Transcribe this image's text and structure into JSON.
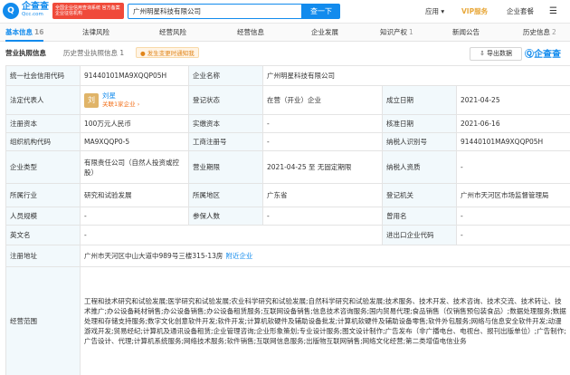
{
  "header": {
    "logo_mark": "Q",
    "logo_name": "企查查",
    "logo_domain": "Qcc.com",
    "slogan": "全国企业信用查询系统 官方备案企业征信机构",
    "search_value": "广州明星科技有限公司",
    "search_button": "查一下",
    "nav_app": "应用",
    "nav_vip": "VIP服务",
    "nav_kit": "企业套餐"
  },
  "tabs": [
    {
      "label": "基本信息",
      "count": "16"
    },
    {
      "label": "法律风险",
      "count": ""
    },
    {
      "label": "经营风险",
      "count": ""
    },
    {
      "label": "经营信息",
      "count": ""
    },
    {
      "label": "企业发展",
      "count": ""
    },
    {
      "label": "知识产权",
      "count": "1"
    },
    {
      "label": "新闻公告",
      "count": ""
    },
    {
      "label": "历史信息",
      "count": "2"
    }
  ],
  "subtabs": {
    "current": "营业执照信息",
    "history": "历史营业执照信息 1",
    "notice": "发生变更时通知我",
    "export": "导出数据",
    "brand": "企查查"
  },
  "info": {
    "credit_code_label": "统一社会信用代码",
    "credit_code": "91440101MA9XQQP05H",
    "company_name_label": "企业名称",
    "company_name": "广州明星科技有限公司",
    "legal_rep_label": "法定代表人",
    "avatar_char": "刘",
    "legal_rep_name": "刘星",
    "legal_rep_related": "关联1家企业 ›",
    "reg_status_label": "登记状态",
    "reg_status": "在营（开业）企业",
    "established_label": "成立日期",
    "established": "2021-04-25",
    "reg_capital_label": "注册资本",
    "reg_capital": "100万元人民币",
    "paid_capital_label": "实缴资本",
    "paid_capital": "-",
    "approved_label": "核准日期",
    "approved": "2021-06-16",
    "org_code_label": "组织机构代码",
    "org_code": "MA9XQQP0-5",
    "biz_reg_no_label": "工商注册号",
    "biz_reg_no": "-",
    "taxpayer_id_label": "纳税人识别号",
    "taxpayer_id": "91440101MA9XQQP05H",
    "ent_type_label": "企业类型",
    "ent_type": "有限责任公司（自然人投资或控股）",
    "biz_term_label": "营业期限",
    "biz_term": "2021-04-25 至 无固定期限",
    "taxpayer_qual_label": "纳税人资质",
    "taxpayer_qual": "-",
    "industry_label": "所属行业",
    "industry": "研究和试验发展",
    "region_label": "所属地区",
    "region": "广东省",
    "authority_label": "登记机关",
    "authority": "广州市天河区市场监督管理局",
    "staff_label": "人员规模",
    "staff": "-",
    "insured_label": "参保人数",
    "insured": "-",
    "former_name_label": "曾用名",
    "former_name": "-",
    "eng_name_label": "英文名",
    "eng_name": "-",
    "import_export_label": "进出口企业代码",
    "import_export": "-",
    "address_label": "注册地址",
    "address": "广州市天河区中山大道中989号三楼315-13房",
    "address_link": "附近企业",
    "scope_label": "经营范围",
    "scope": "工程和技术研究和试验发展;医学研究和试验发展;农业科学研究和试验发展;自然科学研究和试验发展;技术服务、技术开发、技术咨询、技术交流、技术转让、技术推广;办公设备耗材销售;办公设备销售;办公设备租赁服务;互联网设备销售;信息技术咨询服务;国内贸易代理;食品销售（仅销售预包装食品）;数据处理服务;数据处理和存储支持服务;数字文化创意软件开发;软件开发;计算机软硬件及辅助设备批发;计算机软硬件及辅助设备零售;软件外包服务;网络与信息安全软件开发;动漫游戏开发;贸易经纪;计算机及通讯设备租赁;企业管理咨询;企业形象策划;专业设计服务;图文设计制作;广告发布（非广播电台、电视台、报刊出版单位）;广告制作;广告设计、代理;计算机系统服务;网络技术服务;软件销售;互联网信息服务;出版物互联网销售;网络文化经营;第二类增值电信业务"
  },
  "colors": {
    "brand": "#128bed",
    "label_bg": "#f2f9fc",
    "alert": "#f04a3a",
    "vip": "#e8a83b"
  }
}
